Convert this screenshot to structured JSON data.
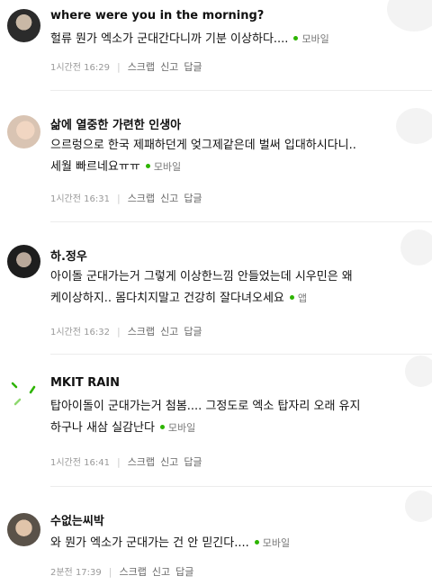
{
  "comments": [
    {
      "username": "where were you in the morning?",
      "lines": [
        "헐류 뭔가 엑소가 군대간다니까 기분 이상하다...."
      ],
      "device": "모바일",
      "time": "1시간전 16:29",
      "actions": [
        "스크랩",
        "신고",
        "답글"
      ]
    },
    {
      "username": "삶에 열중한 가련한 인생아",
      "lines": [
        "으르렁으로 한국 제패하던게 엊그제같은데 벌써 입대하시다니..",
        "세월 빠르네요ㅠㅠ"
      ],
      "device": "모바일",
      "time": "1시간전 16:31",
      "actions": [
        "스크랩",
        "신고",
        "답글"
      ]
    },
    {
      "username": "하.정우",
      "lines": [
        "아이돌 군대가는거 그렇게 이상한느낌 안들었는데 시우민은 왜",
        "케이상하지.. 몸다치지말고 건강히 잘다녀오세요"
      ],
      "device": "앱",
      "time": "1시간전 16:32",
      "actions": [
        "스크랩",
        "신고",
        "답글"
      ]
    },
    {
      "username": "MKIT RAIN",
      "lines": [
        "탑아이돌이 군대가는거 첨봄.... 그정도로 엑소 탑자리 오래 유지",
        "하구나 새삼 실감난다"
      ],
      "device": "모바일",
      "time": "1시간전 16:41",
      "actions": [
        "스크랩",
        "신고",
        "답글"
      ]
    },
    {
      "username": "수없는씨박",
      "lines": [
        "와 뭔가 엑소가 군대가는 건 안 믿긴다...."
      ],
      "device": "모바일",
      "time": "2분전 17:39",
      "actions": [
        "스크랩",
        "신고",
        "답글"
      ]
    }
  ],
  "colors": {
    "device_dot": "#2db400",
    "meta_text": "#888888"
  },
  "icons": [
    "profile-avatar",
    "mkit-rain-logo",
    "green-dot-icon"
  ]
}
